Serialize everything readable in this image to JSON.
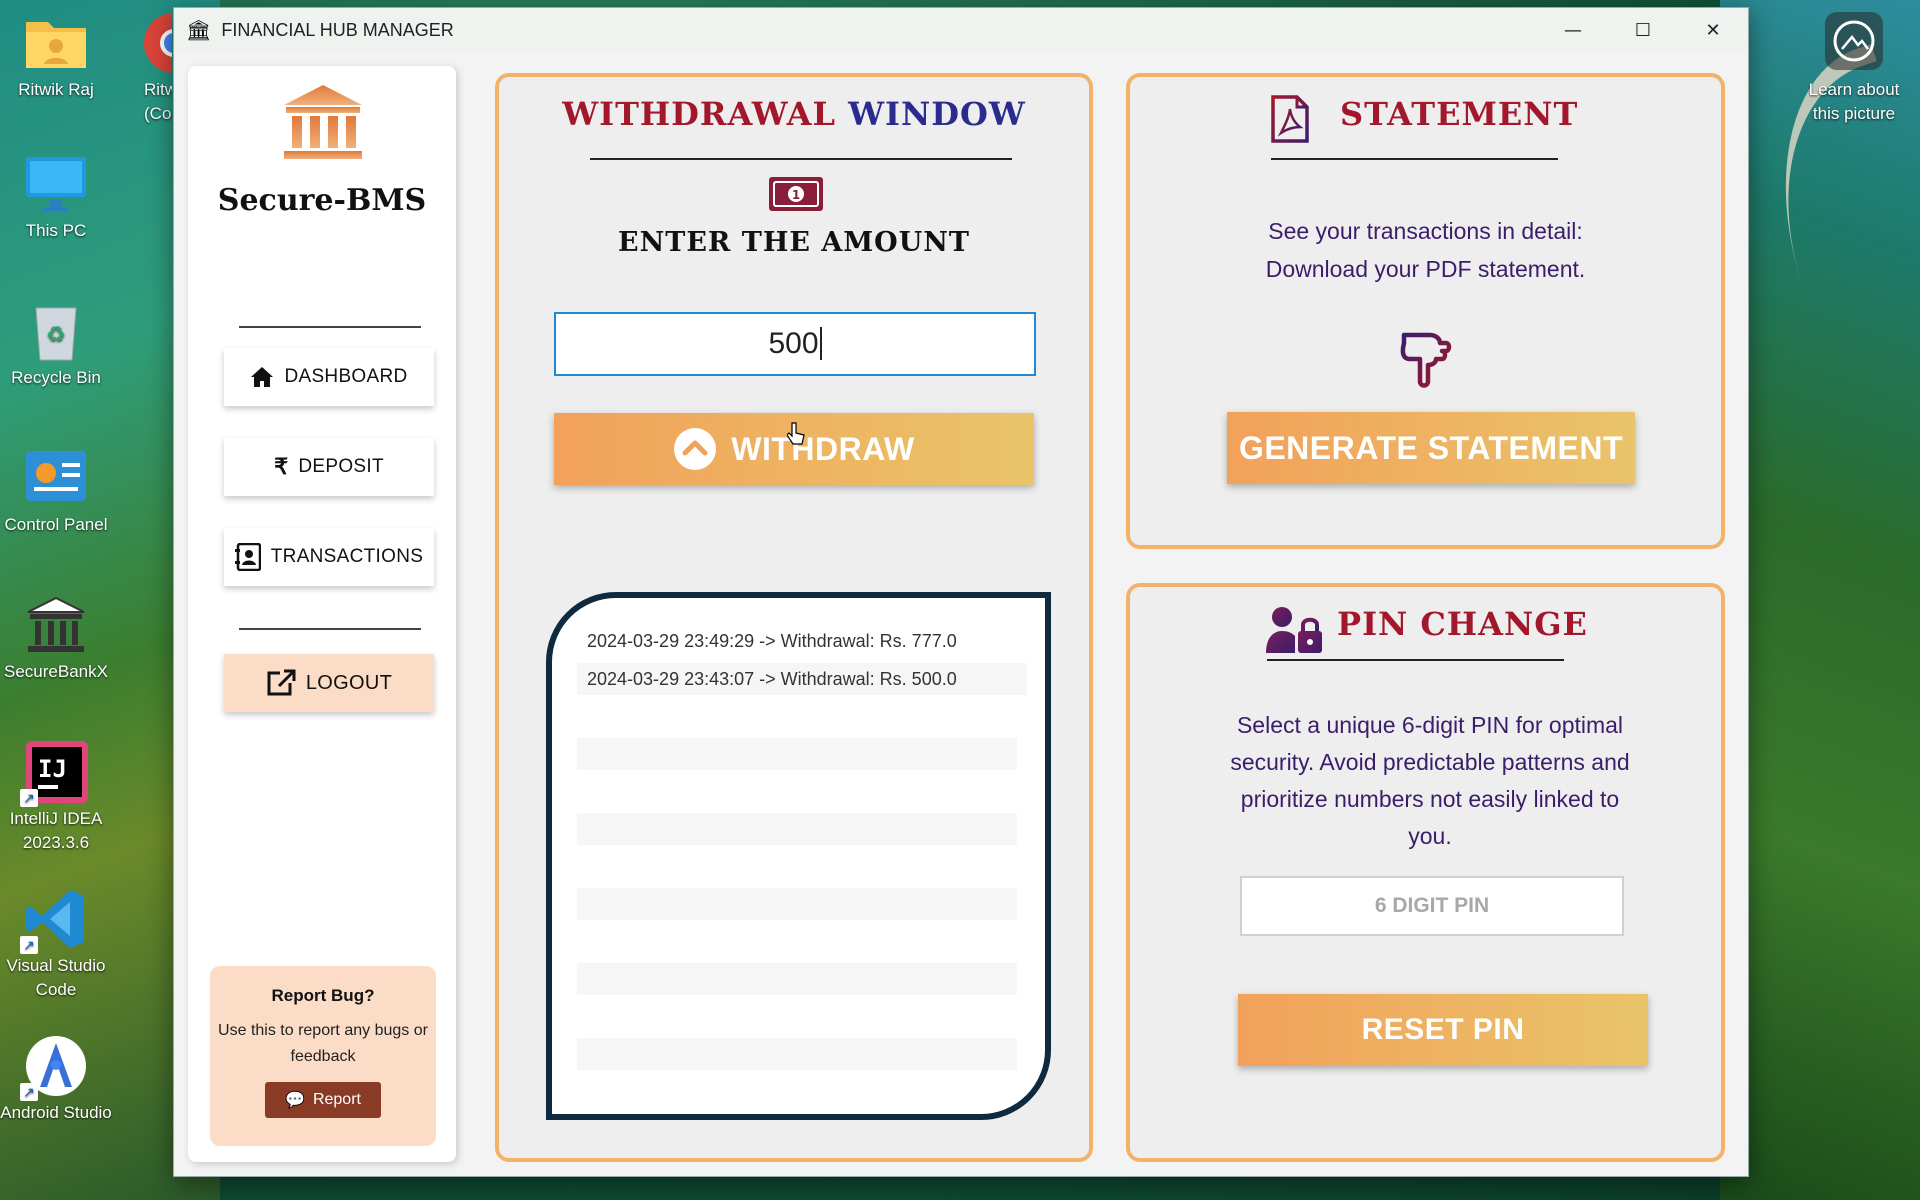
{
  "desktop": {
    "icons": [
      {
        "label": "Ritwik Raj",
        "icon": "user-folder-icon"
      },
      {
        "label": "This PC",
        "icon": "monitor-icon"
      },
      {
        "label": "Recycle Bin",
        "icon": "recycle-bin-icon"
      },
      {
        "label": "Control Panel",
        "icon": "control-panel-icon"
      },
      {
        "label": "SecureBankX",
        "icon": "bank-icon"
      },
      {
        "label": "IntelliJ IDEA 2023.3.6",
        "icon": "intellij-icon"
      },
      {
        "label": "Visual Studio Code",
        "icon": "vscode-icon"
      },
      {
        "label": "Android Studio",
        "icon": "android-studio-icon"
      }
    ],
    "partial_icon_label": "Ritw (Codin",
    "learn_label": "Learn about this picture"
  },
  "window": {
    "title": "FINANCIAL HUB MANAGER",
    "controls": {
      "minimize": "—",
      "maximize": "☐",
      "close": "✕"
    }
  },
  "sidebar": {
    "brand": "Secure-BMS",
    "nav": [
      {
        "label": "DASHBOARD",
        "icon": "home-icon"
      },
      {
        "label": "DEPOSIT",
        "icon": "rupee-icon"
      },
      {
        "label": "TRANSACTIONS",
        "icon": "contact-book-icon"
      }
    ],
    "logout": "LOGOUT",
    "bug": {
      "title": "Report Bug?",
      "text": "Use this to report any bugs or feedback",
      "button": "Report"
    }
  },
  "withdraw": {
    "title_part1": "WITHDRAWAL",
    "title_part2": "WINDOW",
    "prompt": "ENTER THE AMOUNT",
    "amount": "500",
    "button": "WITHDRAW",
    "transactions": [
      "2024-03-29 23:49:29 -> Withdrawal: Rs. 777.0",
      "2024-03-29 23:43:07 -> Withdrawal: Rs. 500.0"
    ]
  },
  "statement": {
    "title": "STATEMENT",
    "line1": "See your transactions in detail:",
    "line2": "Download your PDF statement.",
    "button": "GENERATE STATEMENT"
  },
  "pin": {
    "title": "PIN CHANGE",
    "description": "Select a unique 6-digit PIN for optimal security. Avoid predictable patterns and prioritize numbers not easily linked to you.",
    "placeholder": "6 DIGIT PIN",
    "button": "RESET PIN"
  },
  "colors": {
    "accent_orange": "#f2a15a",
    "accent_gold": "#e9c46a",
    "title_red": "#a3172b",
    "title_blue": "#2a2a8f",
    "text_purple": "#3b1d6b",
    "card_border": "#0d2a3f",
    "bug_bg": "#fbdcc6"
  }
}
